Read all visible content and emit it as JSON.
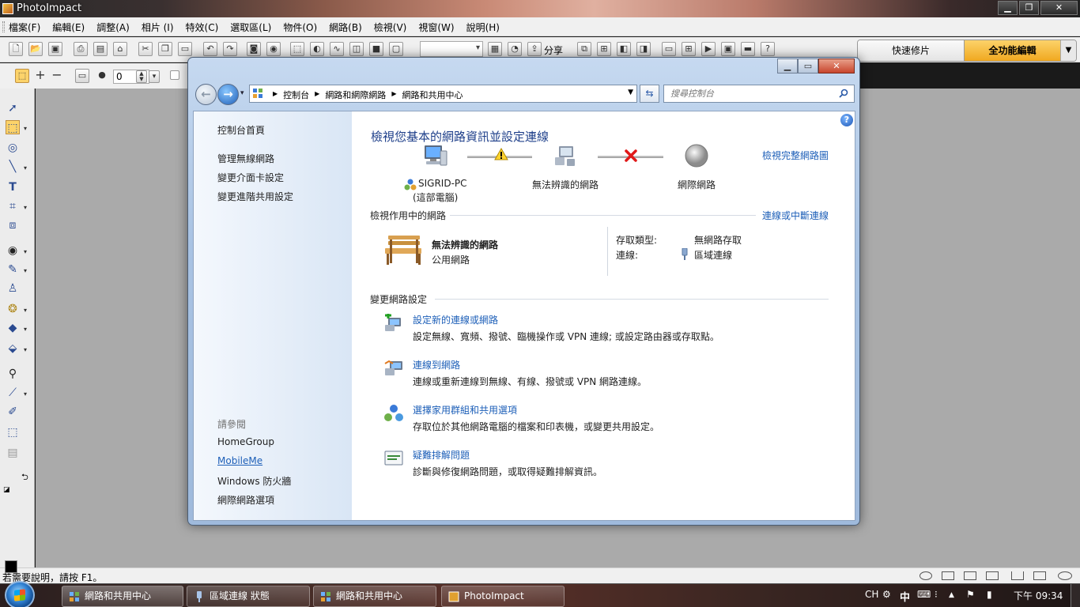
{
  "app": {
    "title": "PhotoImpact",
    "menu": [
      "檔案(F)",
      "編輯(E)",
      "調整(A)",
      "相片 (I)",
      "特效(C)",
      "選取區(L)",
      "物件(O)",
      "網路(B)",
      "檢視(V)",
      "視窗(W)",
      "說明(H)"
    ],
    "share_label": "分享",
    "modes": {
      "quick": "快速修片",
      "full": "全功能編輯"
    },
    "attr_value": "0",
    "status_text": "若需要說明，請按 F1。"
  },
  "window": {
    "address": {
      "crumbs": [
        "控制台",
        "網路和網際網路",
        "網路和共用中心"
      ]
    },
    "search_placeholder": "搜尋控制台",
    "sidebar": {
      "home": "控制台首頁",
      "links": [
        "管理無線網路",
        "變更介面卡設定",
        "變更進階共用設定"
      ],
      "see_also_heading": "請參閱",
      "see_also": [
        "HomeGroup",
        "MobileMe",
        "Windows 防火牆",
        "網際網路選項"
      ]
    },
    "main": {
      "title": "檢視您基本的網路資訊並設定連線",
      "full_map_link": "檢視完整網路圖",
      "map": {
        "pc_name": "SIGRID-PC",
        "pc_sub": "(這部電腦)",
        "unidentified": "無法辨識的網路",
        "internet": "網際網路"
      },
      "active_networks": {
        "heading": "檢視作用中的網路",
        "connect_link": "連線或中斷連線",
        "network_name": "無法辨識的網路",
        "network_type": "公用網路",
        "access_type_label": "存取類型:",
        "access_type_value": "無網路存取",
        "connections_label": "連線:",
        "connections_value": "區域連線"
      },
      "change_settings": {
        "heading": "變更網路設定",
        "tasks": [
          {
            "title": "設定新的連線或網路",
            "desc": "設定無線、寬頻、撥號、臨機操作或 VPN 連線; 或設定路由器或存取點。"
          },
          {
            "title": "連線到網路",
            "desc": "連線或重新連線到無線、有線、撥號或 VPN 網路連線。"
          },
          {
            "title": "選擇家用群組和共用選項",
            "desc": "存取位於其他網路電腦的檔案和印表機，或變更共用設定。"
          },
          {
            "title": "疑難排解問題",
            "desc": "診斷與修復網路問題，或取得疑難排解資訊。"
          }
        ]
      }
    }
  },
  "taskbar": {
    "buttons": [
      "網路和共用中心",
      "區域連線 狀態",
      "網路和共用中心",
      "PhotoImpact"
    ],
    "lang": "CH",
    "ime": "中",
    "clock": "下午 09:34"
  }
}
